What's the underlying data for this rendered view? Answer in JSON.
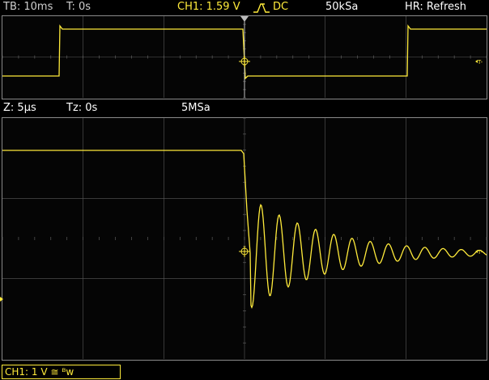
{
  "top_bar": {
    "timebase": "TB: 10ms",
    "trigger_time": "T: 0s",
    "channel": "CH1: 1.59 V",
    "edge_symbol": "⎍",
    "coupling": "DC",
    "sample_rate": "50kSa",
    "hr_mode": "HR: Refresh"
  },
  "zoom_bar": {
    "zoom": "Z: 5µs",
    "zoom_time": "Tz: 0s",
    "zoom_rate": "5MSa"
  },
  "footer": {
    "channel_setting": "CH1: 1 V ≅ ᴮw"
  },
  "markers": {
    "trigger_label": "T-"
  },
  "colors": {
    "trace": "#ffeb3b",
    "grid": "#5a5a5a",
    "dots": "#6a6a6a"
  }
}
